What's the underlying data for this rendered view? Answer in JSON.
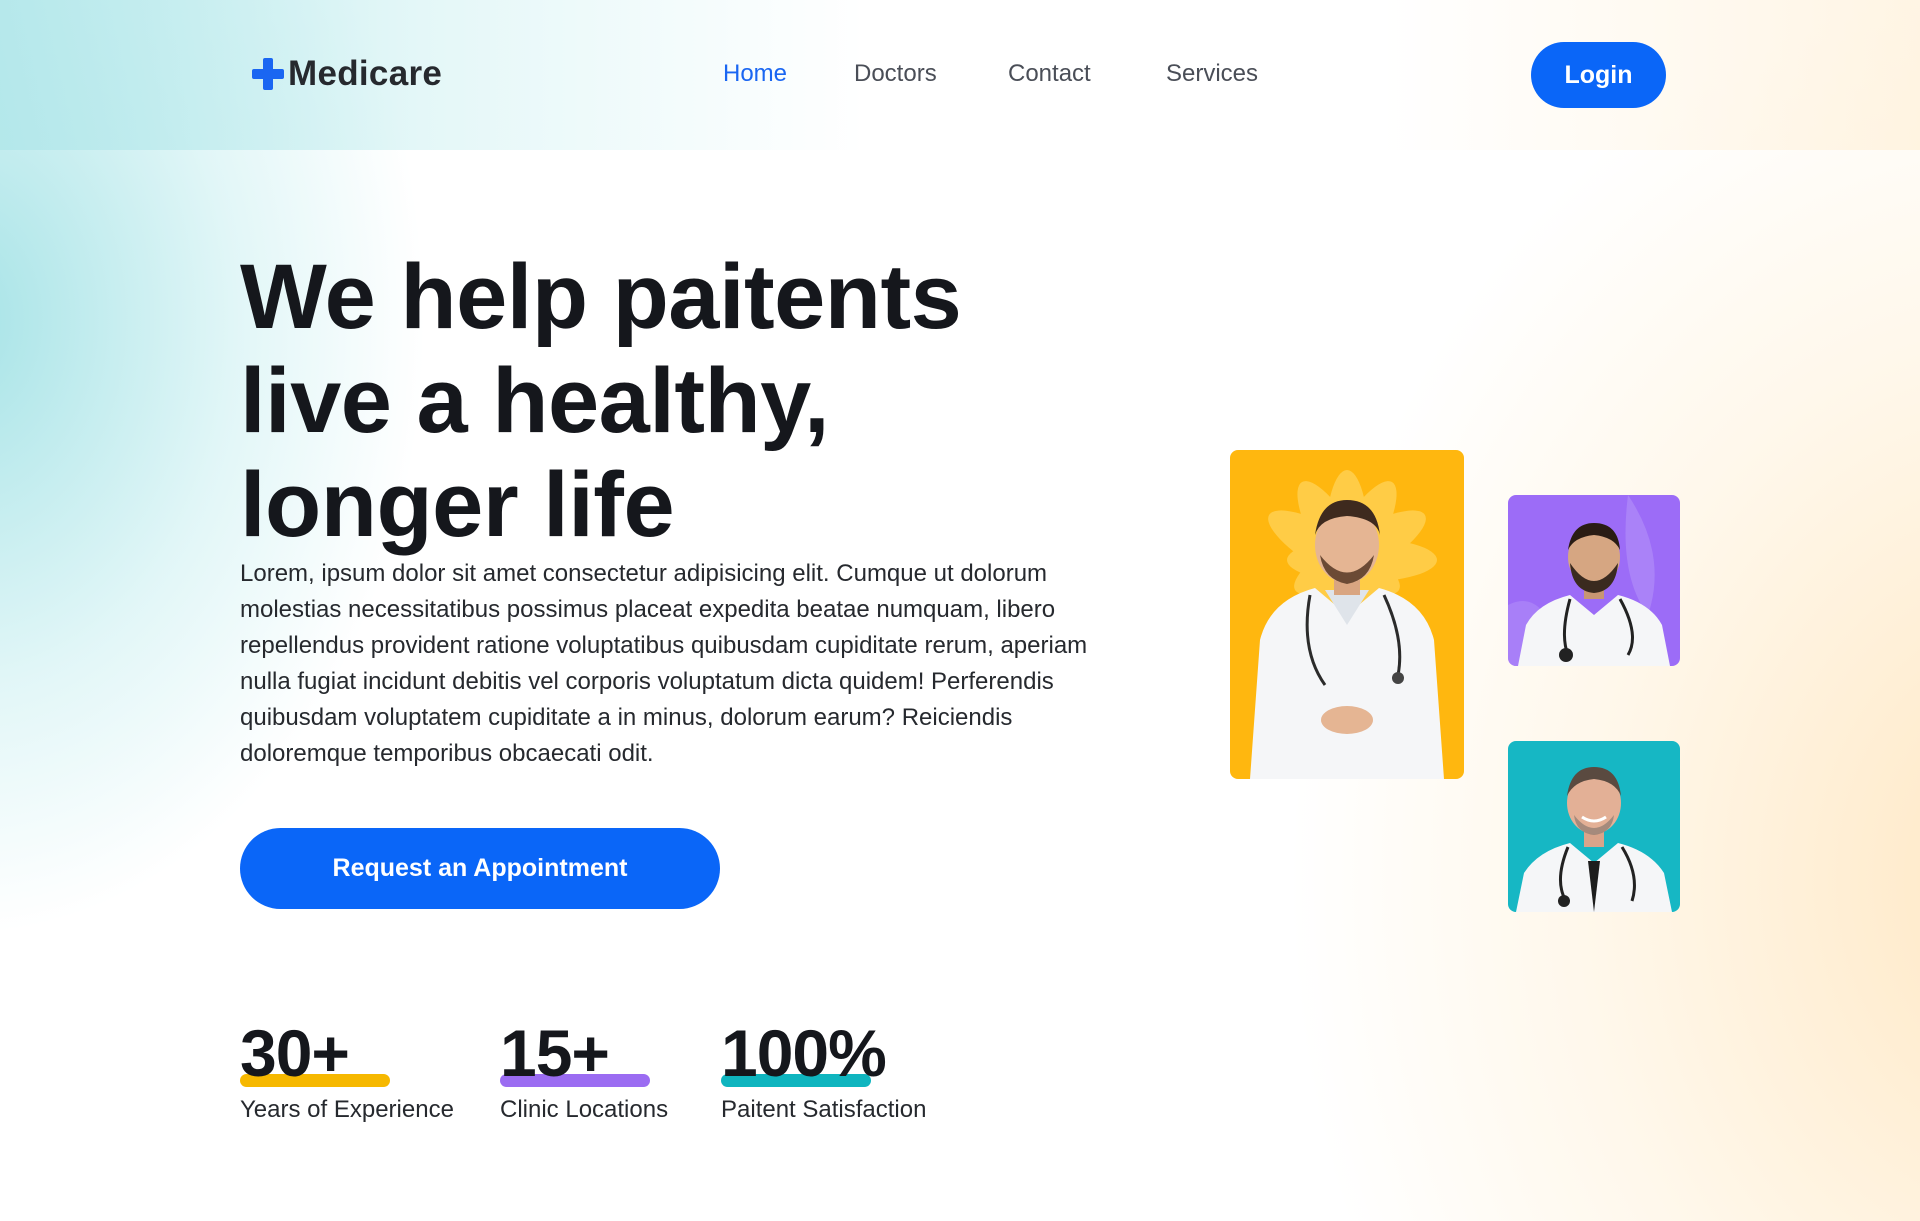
{
  "header": {
    "brand": "Medicare",
    "nav": [
      {
        "label": "Home",
        "active": true
      },
      {
        "label": "Doctors"
      },
      {
        "label": "Contact"
      },
      {
        "label": "Services"
      }
    ],
    "login_label": "Login"
  },
  "hero": {
    "title_lines": [
      "We help paitents",
      "live a healthy,",
      "longer life"
    ],
    "description": "Lorem, ipsum dolor sit amet consectetur adipisicing elit. Cumque ut dolorum molestias necessitatibus possimus placeat expedita beatae numquam, libero repellendus provident ratione voluptatibus quibusdam cupiditate rerum, aperiam nulla fugiat incidunt debitis vel corporis voluptatum dicta quidem! Perferendis quibusdam voluptatem cupiditate a in minus, dolorum earum? Reiciendis doloremque temporibus obcaecati odit.",
    "cta_label": "Request an Appointment"
  },
  "stats": [
    {
      "value": "30+",
      "label": "Years of Experience",
      "accent": "#f6b800"
    },
    {
      "value": "15+",
      "label": "Clinic Locations",
      "accent": "#9b6cf2"
    },
    {
      "value": "100%",
      "label": "Paitent Satisfaction",
      "accent": "#0fb5bf"
    }
  ],
  "doctors": [
    {
      "name": "doctor-photo-1",
      "background": "#ffb70f"
    },
    {
      "name": "doctor-photo-2",
      "background": "#9c6cf7"
    },
    {
      "name": "doctor-photo-3",
      "background": "#16b7c4"
    }
  ],
  "colors": {
    "primary": "#0a66f8",
    "text": "#15171c"
  }
}
